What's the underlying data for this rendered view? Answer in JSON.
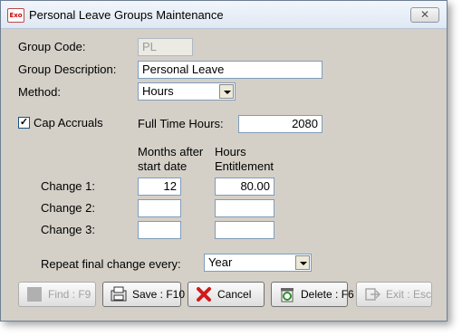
{
  "window": {
    "title": "Personal Leave Groups Maintenance",
    "app_icon_text": "Exo"
  },
  "form": {
    "group_code_label": "Group Code:",
    "group_code_value": "PL",
    "group_description_label": "Group Description:",
    "group_description_value": "Personal Leave",
    "method_label": "Method:",
    "method_value": "Hours",
    "cap_accruals_label": "Cap Accruals",
    "cap_accruals_checked": true,
    "full_time_hours_label": "Full Time Hours:",
    "full_time_hours_value": "2080",
    "col_months_header_1": "Months after",
    "col_months_header_2": "start date",
    "col_hours_header_1": "Hours",
    "col_hours_header_2": "Entitlement",
    "changes": [
      {
        "label": "Change 1:",
        "months": "12",
        "hours": "80.00"
      },
      {
        "label": "Change 2:",
        "months": "",
        "hours": ""
      },
      {
        "label": "Change 3:",
        "months": "",
        "hours": ""
      }
    ],
    "repeat_label": "Repeat final change every:",
    "repeat_value": "Year"
  },
  "buttons": {
    "find": "Find : F9",
    "save": "Save : F10",
    "cancel": "Cancel",
    "delete": "Delete : F6",
    "exit": "Exit : Esc"
  },
  "colors": {
    "cancel_icon": "#d11a1a",
    "delete_icon": "#2f8f2f",
    "window_bg": "#d4d0c8"
  }
}
